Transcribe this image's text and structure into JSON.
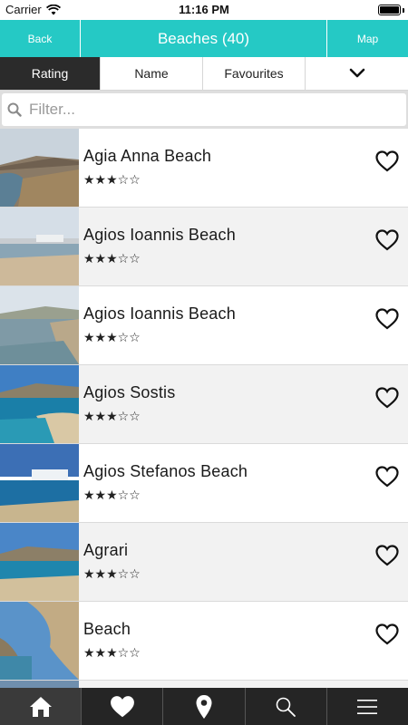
{
  "status_bar": {
    "carrier": "Carrier",
    "time": "11:16 PM"
  },
  "nav": {
    "back_label": "Back",
    "title": "Beaches (40)",
    "map_label": "Map"
  },
  "sort_tabs": [
    {
      "label": "Rating",
      "active": true
    },
    {
      "label": "Name",
      "active": false
    },
    {
      "label": "Favourites",
      "active": false
    }
  ],
  "search": {
    "placeholder": "Filter..."
  },
  "beaches": [
    {
      "name": "Agia Anna Beach",
      "rating": 3,
      "stars": "★★★☆☆",
      "favourite": false
    },
    {
      "name": "Agios Ioannis Beach",
      "rating": 3,
      "stars": "★★★☆☆",
      "favourite": false
    },
    {
      "name": "Agios Ioannis Beach",
      "rating": 3,
      "stars": "★★★☆☆",
      "favourite": false
    },
    {
      "name": "Agios Sostis",
      "rating": 3,
      "stars": "★★★☆☆",
      "favourite": false
    },
    {
      "name": "Agios Stefanos Beach",
      "rating": 3,
      "stars": "★★★☆☆",
      "favourite": false
    },
    {
      "name": "Agrari",
      "rating": 3,
      "stars": "★★★☆☆",
      "favourite": false
    },
    {
      "name": "Beach",
      "rating": 3,
      "stars": "★★★☆☆",
      "favourite": false
    }
  ],
  "tab_bar": [
    {
      "icon": "home-icon",
      "active": true
    },
    {
      "icon": "heart-icon",
      "active": false
    },
    {
      "icon": "map-pin-icon",
      "active": false
    },
    {
      "icon": "search-icon",
      "active": false
    },
    {
      "icon": "menu-icon",
      "active": false
    }
  ],
  "colors": {
    "accent": "#25c9c5",
    "dark": "#2b2b2b",
    "tab_bar": "#252525"
  }
}
